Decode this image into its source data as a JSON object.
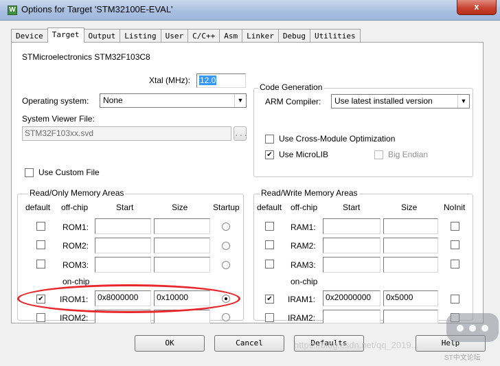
{
  "window": {
    "title": "Options for Target 'STM32100E-EVAL'",
    "close_glyph": "x",
    "app_icon": "W"
  },
  "tabs": [
    "Device",
    "Target",
    "Output",
    "Listing",
    "User",
    "C/C++",
    "Asm",
    "Linker",
    "Debug",
    "Utilities"
  ],
  "device_name": "STMicroelectronics STM32F103C8",
  "xtal": {
    "label": "Xtal (MHz):",
    "value": "12.0"
  },
  "os": {
    "label": "Operating system:",
    "value": "None"
  },
  "svd": {
    "label": "System Viewer File:",
    "value": "STM32F103xx.svd",
    "browse": "..."
  },
  "custom_file": {
    "label": "Use Custom File",
    "checked": false
  },
  "code_generation": {
    "title": "Code Generation",
    "compiler_label": "ARM Compiler:",
    "compiler_value": "Use latest installed version",
    "cross_module": {
      "label": "Use Cross-Module Optimization",
      "checked": false
    },
    "microlib": {
      "label": "Use MicroLIB",
      "checked": true
    },
    "big_endian": {
      "label": "Big Endian",
      "checked": false
    }
  },
  "ro_memory": {
    "title": "Read/Only Memory Areas",
    "headers": {
      "default": "default",
      "offchip": "off-chip",
      "start": "Start",
      "size": "Size",
      "startup": "Startup"
    },
    "onchip_label": "on-chip",
    "rows": [
      {
        "name": "ROM1:",
        "default": false,
        "start": "",
        "size": "",
        "startup": false
      },
      {
        "name": "ROM2:",
        "default": false,
        "start": "",
        "size": "",
        "startup": false
      },
      {
        "name": "ROM3:",
        "default": false,
        "start": "",
        "size": "",
        "startup": false
      },
      {
        "name": "IROM1:",
        "default": true,
        "start": "0x8000000",
        "size": "0x10000",
        "startup": true
      },
      {
        "name": "IROM2:",
        "default": false,
        "start": "",
        "size": "",
        "startup": false
      }
    ]
  },
  "rw_memory": {
    "title": "Read/Write Memory Areas",
    "headers": {
      "default": "default",
      "offchip": "off-chip",
      "start": "Start",
      "size": "Size",
      "noinit": "NoInit"
    },
    "onchip_label": "on-chip",
    "rows": [
      {
        "name": "RAM1:",
        "default": false,
        "start": "",
        "size": "",
        "noinit": false
      },
      {
        "name": "RAM2:",
        "default": false,
        "start": "",
        "size": "",
        "noinit": false
      },
      {
        "name": "RAM3:",
        "default": false,
        "start": "",
        "size": "",
        "noinit": false
      },
      {
        "name": "IRAM1:",
        "default": true,
        "start": "0x20000000",
        "size": "0x5000",
        "noinit": false
      },
      {
        "name": "IRAM2:",
        "default": false,
        "start": "",
        "size": "",
        "noinit": false
      }
    ]
  },
  "buttons": {
    "ok": "OK",
    "cancel": "Cancel",
    "defaults": "Defaults",
    "help": "Help"
  },
  "watermark": {
    "url": "https://blog.csdn.net/qq_2019...",
    "brand": "ST中文论坛"
  },
  "colors": {
    "highlight": "#e8262b",
    "selection": "#3399ff"
  }
}
